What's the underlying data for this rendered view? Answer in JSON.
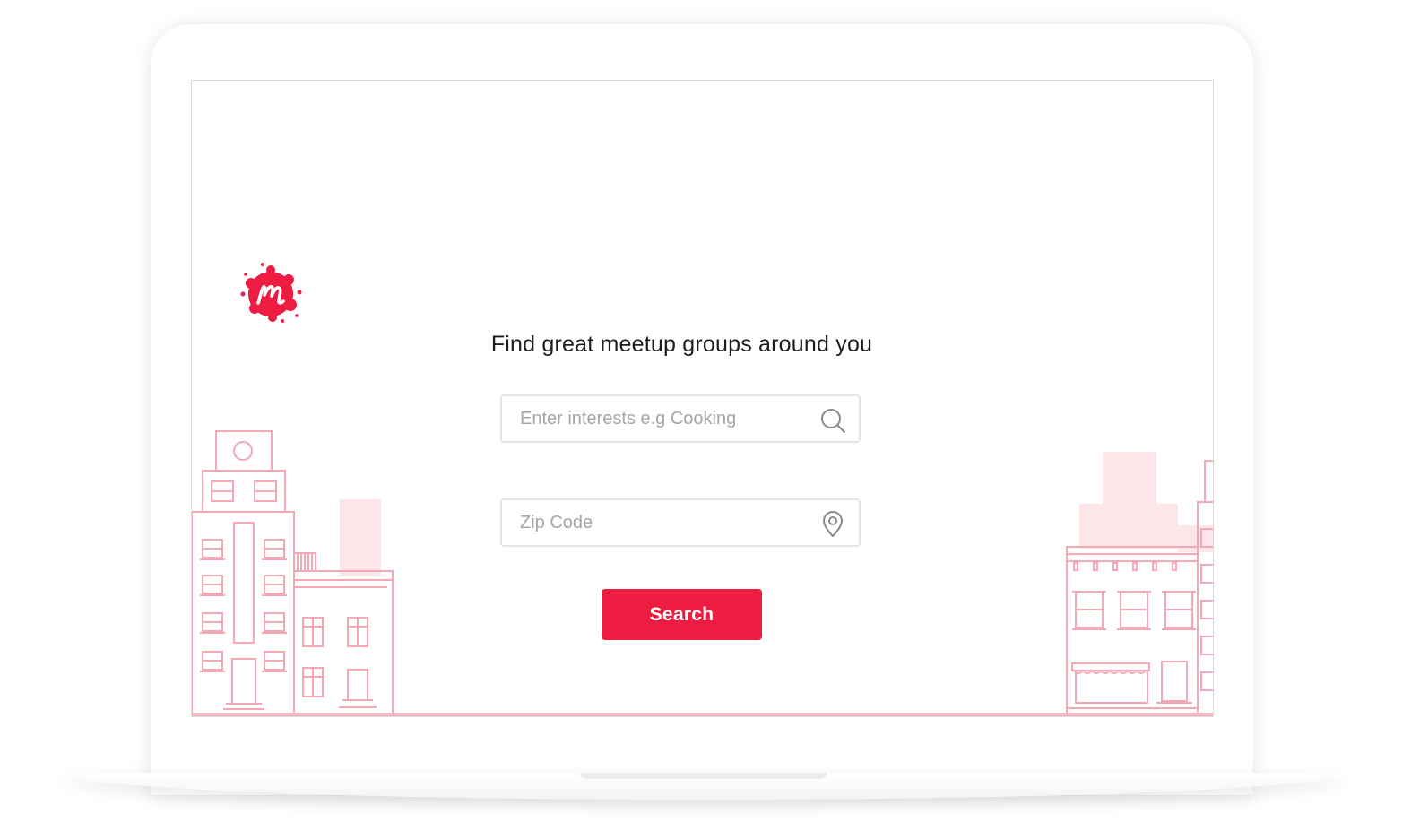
{
  "brand": {
    "name": "Meetup",
    "accent_color": "#ed1c40",
    "illustration_color": "#f4a7b5"
  },
  "main": {
    "headline": "Find great meetup groups around you",
    "interests_input": {
      "value": "",
      "placeholder": "Enter interests e.g Cooking",
      "icon": "search-icon"
    },
    "zip_input": {
      "value": "",
      "placeholder": "Zip Code",
      "icon": "location-pin-icon"
    },
    "search_button_label": "Search"
  }
}
